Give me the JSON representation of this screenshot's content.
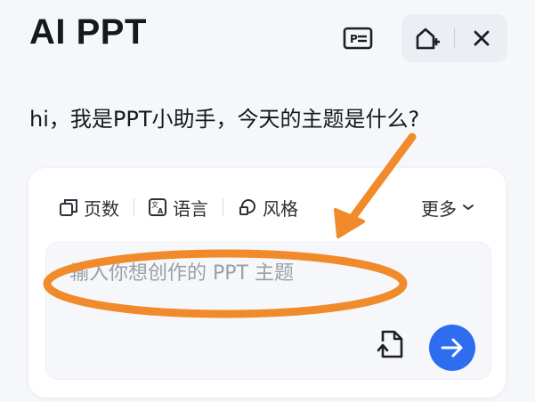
{
  "header": {
    "title": "AI PPT",
    "slides_icon": "slides-icon",
    "new_chat_icon": "new-chat-icon",
    "close_icon": "close-icon"
  },
  "greeting": "hi，我是PPT小助手，今天的主题是什么?",
  "options": {
    "pages_label": "页数",
    "pages_icon": "pages-icon",
    "language_label": "语言",
    "language_icon": "language-icon",
    "style_label": "风格",
    "style_icon": "style-icon",
    "more_label": "更多",
    "more_icon": "chevron-down-icon"
  },
  "input": {
    "placeholder": "输入你想创作的 PPT 主题",
    "value": ""
  },
  "actions": {
    "upload_icon": "upload-file-icon",
    "send_icon": "arrow-right-icon"
  },
  "annotation": {
    "color": "#f08a2a"
  },
  "colors": {
    "accent": "#2e6cf0",
    "background": "#f6f7fb",
    "annotation": "#f08a2a"
  }
}
